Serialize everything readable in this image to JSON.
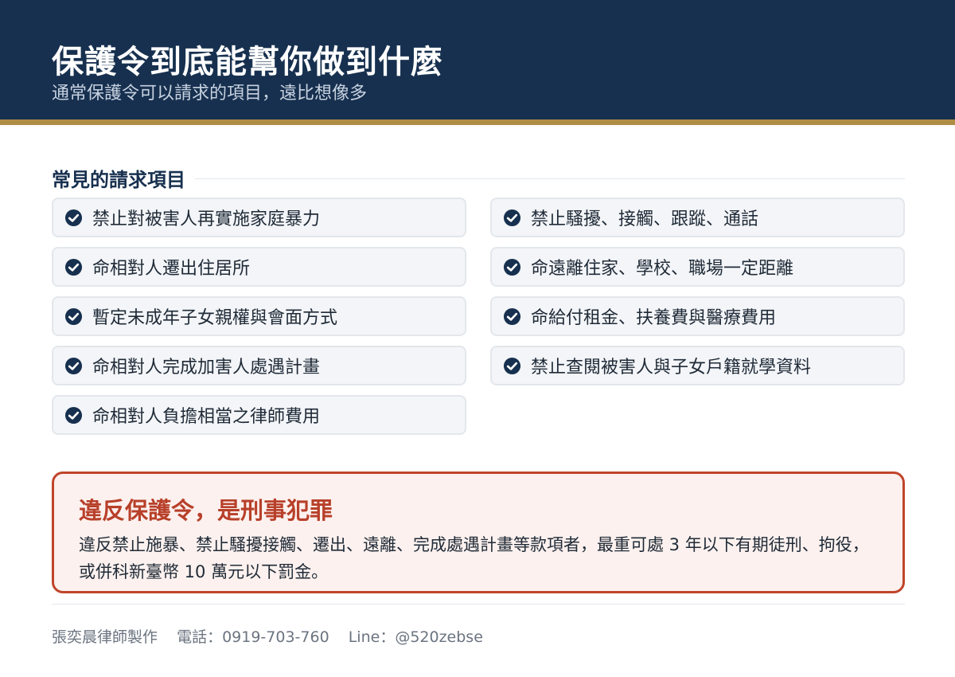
{
  "header": {
    "title": "保護令到底能幫你做到什麼",
    "subtitle": "通常保護令可以請求的項目，遠比想像多"
  },
  "section": {
    "heading": "常見的請求項目"
  },
  "items": {
    "left": [
      "禁止對被害人再實施家庭暴力",
      "命相對人遷出住居所",
      "暫定未成年子女親權與會面方式",
      "命相對人完成加害人處遇計畫",
      "命相對人負擔相當之律師費用"
    ],
    "right": [
      "禁止騷擾、接觸、跟蹤、通話",
      "命遠離住家、學校、職場一定距離",
      "命給付租金、扶養費與醫療費用",
      "禁止查閱被害人與子女戶籍就學資料"
    ]
  },
  "warning": {
    "title": "違反保護令，是刑事犯罪",
    "body": "違反禁止施暴、禁止騷擾接觸、遷出、遠離、完成處遇計畫等款項者，最重可處 3 年以下有期徒刑、拘役，或併科新臺幣 10 萬元以下罰金。"
  },
  "footer": {
    "author": "張奕晨律師製作",
    "phone": "電話：0919-703-760",
    "line": "Line：@520zebse"
  },
  "colors": {
    "header_bg": "#17304f",
    "accent_gold": "#b08d45",
    "warning_red": "#c0452b",
    "check_navy": "#17304f"
  },
  "icons": {
    "item_marker": "check-circle-icon"
  }
}
